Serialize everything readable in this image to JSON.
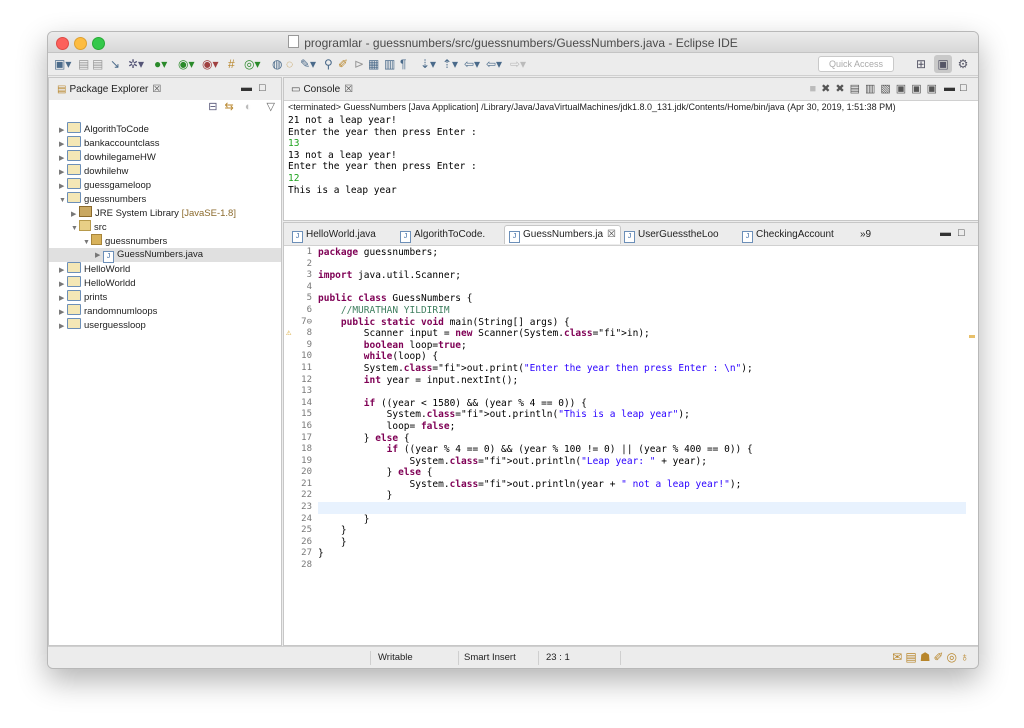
{
  "window": {
    "title": "programlar - guessnumbers/src/guessnumbers/GuessNumbers.java - Eclipse IDE"
  },
  "toolbar": {
    "quick_access_placeholder": "Quick Access"
  },
  "package_explorer": {
    "tab_label": "Package Explorer",
    "items": [
      {
        "label": "AlgorithToCode",
        "level": 0,
        "kind": "project"
      },
      {
        "label": "bankaccountclass",
        "level": 0,
        "kind": "project"
      },
      {
        "label": "dowhilegameHW",
        "level": 0,
        "kind": "project"
      },
      {
        "label": "dowhilehw",
        "level": 0,
        "kind": "project"
      },
      {
        "label": "guessgameloop",
        "level": 0,
        "kind": "project"
      },
      {
        "label": "guessnumbers",
        "level": 0,
        "kind": "project",
        "expanded": true
      },
      {
        "label": "JRE System Library",
        "suffix": "[JavaSE-1.8]",
        "level": 1,
        "kind": "library"
      },
      {
        "label": "src",
        "level": 1,
        "kind": "src",
        "expanded": true
      },
      {
        "label": "guessnumbers",
        "level": 2,
        "kind": "package",
        "expanded": true
      },
      {
        "label": "GuessNumbers.java",
        "level": 3,
        "kind": "file",
        "selected": true
      },
      {
        "label": "HelloWorld",
        "level": 0,
        "kind": "project"
      },
      {
        "label": "HelloWorldd",
        "level": 0,
        "kind": "project"
      },
      {
        "label": "prints",
        "level": 0,
        "kind": "project"
      },
      {
        "label": "randomnumloops",
        "level": 0,
        "kind": "project"
      },
      {
        "label": "userguessloop",
        "level": 0,
        "kind": "project"
      }
    ]
  },
  "console": {
    "tab_label": "Console",
    "terminated_line": "<terminated> GuessNumbers [Java Application] /Library/Java/JavaVirtualMachines/jdk1.8.0_131.jdk/Contents/Home/bin/java (Apr 30, 2019, 1:51:38 PM)",
    "lines": [
      {
        "text": "21 not a leap year!",
        "input": false
      },
      {
        "text": "Enter the year then press Enter :",
        "input": false
      },
      {
        "text": "13",
        "input": true
      },
      {
        "text": "13 not a leap year!",
        "input": false
      },
      {
        "text": "Enter the year then press Enter :",
        "input": false
      },
      {
        "text": "12",
        "input": true
      },
      {
        "text": "This is a leap year",
        "input": false
      }
    ]
  },
  "editor": {
    "tabs": [
      {
        "label": "HelloWorld.java",
        "active": false
      },
      {
        "label": "AlgorithToCode.",
        "active": false
      },
      {
        "label": "GuessNumbers.ja",
        "active": true
      },
      {
        "label": "UserGuesstheLoo",
        "active": false
      },
      {
        "label": "CheckingAccount",
        "active": false
      }
    ],
    "overflow_label": "»9",
    "current_line": 23,
    "code_lines": [
      "package guessnumbers;",
      "",
      "import java.util.Scanner;",
      "",
      "public class GuessNumbers {",
      "    //MURATHAN YILDIRIM",
      "    public static void main(String[] args) {",
      "        Scanner input = new Scanner(System.in);",
      "        boolean loop=true;",
      "        while(loop) {",
      "        System.out.print(\"Enter the year then press Enter : \\n\");",
      "        int year = input.nextInt();",
      "",
      "        if ((year < 1580) && (year % 4 == 0)) {",
      "            System.out.println(\"This is a leap year\");",
      "            loop= false;",
      "        } else {",
      "            if ((year % 4 == 0) && (year % 100 != 0) || (year % 400 == 0)) {",
      "                System.out.println(\"Leap year: \" + year);",
      "            } else {",
      "                System.out.println(year + \" not a leap year!\");",
      "            }",
      "",
      "        }",
      "    }",
      "    }",
      "}",
      ""
    ]
  },
  "status_bar": {
    "mode": "Writable",
    "insert_mode": "Smart Insert",
    "position": "23 : 1"
  }
}
